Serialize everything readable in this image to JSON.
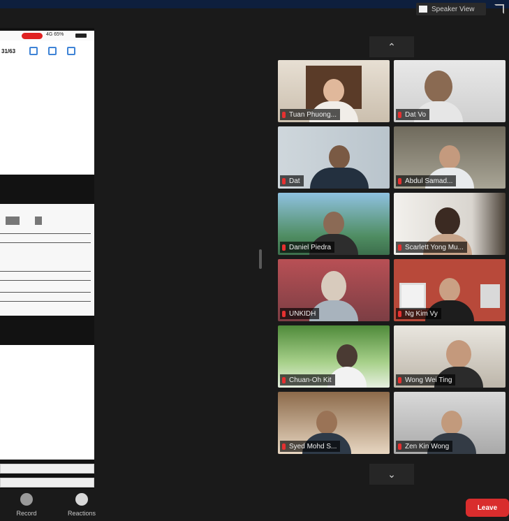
{
  "toolbar": {
    "view_label": "Speaker View",
    "leave_label": "Leave"
  },
  "shared_screen": {
    "page_number": "31/63",
    "status_text": "4G 65%"
  },
  "controls": [
    {
      "label": "Record"
    },
    {
      "label": "Reactions"
    }
  ],
  "participants": [
    {
      "name": "Tuan Phuong..."
    },
    {
      "name": "Dat Vo"
    },
    {
      "name": "Dat"
    },
    {
      "name": "Abdul Samad..."
    },
    {
      "name": "Daniel Piedra"
    },
    {
      "name": "Scarlett Yong Mu..."
    },
    {
      "name": "UNKIDH"
    },
    {
      "name": "Ng Kim Vy"
    },
    {
      "name": "Chuan-Oh Kit"
    },
    {
      "name": "Wong Wei Ting"
    },
    {
      "name": "Syed Mohd S..."
    },
    {
      "name": "Zen Kin Wong"
    }
  ],
  "colors": {
    "leave": "#d92d2d",
    "topbar": "#0e1f3d",
    "mic_muted": "#e63030"
  }
}
